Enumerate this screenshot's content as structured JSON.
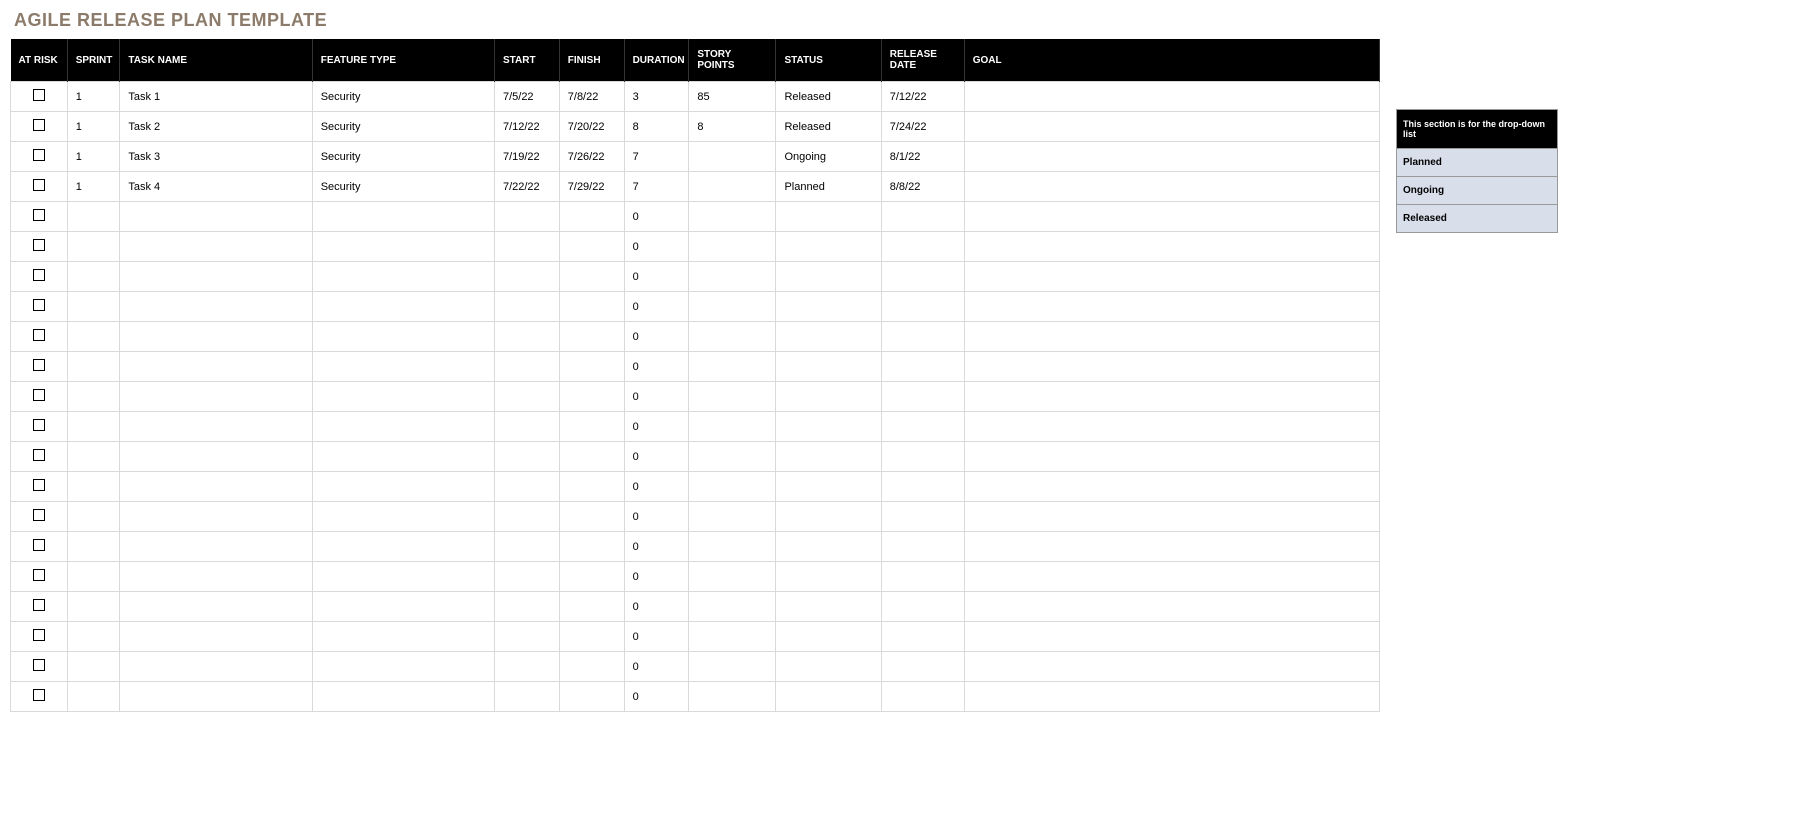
{
  "title": "AGILE RELEASE PLAN TEMPLATE",
  "columns": [
    "AT RISK",
    "SPRINT",
    "TASK NAME",
    "FEATURE TYPE",
    "START",
    "FINISH",
    "DURATION",
    "STORY POINTS",
    "STATUS",
    "RELEASE DATE",
    "GOAL"
  ],
  "rows": [
    {
      "at_risk": false,
      "sprint": "1",
      "task_name": "Task 1",
      "feature_type": "Security",
      "start": "7/5/22",
      "finish": "7/8/22",
      "duration": "3",
      "story_points": "85",
      "status": "Released",
      "release_date": "7/12/22",
      "goal": ""
    },
    {
      "at_risk": false,
      "sprint": "1",
      "task_name": "Task 2",
      "feature_type": "Security",
      "start": "7/12/22",
      "finish": "7/20/22",
      "duration": "8",
      "story_points": "8",
      "status": "Released",
      "release_date": "7/24/22",
      "goal": ""
    },
    {
      "at_risk": false,
      "sprint": "1",
      "task_name": "Task 3",
      "feature_type": "Security",
      "start": "7/19/22",
      "finish": "7/26/22",
      "duration": "7",
      "story_points": "",
      "status": "Ongoing",
      "release_date": "8/1/22",
      "goal": ""
    },
    {
      "at_risk": false,
      "sprint": "1",
      "task_name": "Task 4",
      "feature_type": "Security",
      "start": "7/22/22",
      "finish": "7/29/22",
      "duration": "7",
      "story_points": "",
      "status": "Planned",
      "release_date": "8/8/22",
      "goal": ""
    },
    {
      "at_risk": false,
      "sprint": "",
      "task_name": "",
      "feature_type": "",
      "start": "",
      "finish": "",
      "duration": "0",
      "story_points": "",
      "status": "",
      "release_date": "",
      "goal": ""
    },
    {
      "at_risk": false,
      "sprint": "",
      "task_name": "",
      "feature_type": "",
      "start": "",
      "finish": "",
      "duration": "0",
      "story_points": "",
      "status": "",
      "release_date": "",
      "goal": ""
    },
    {
      "at_risk": false,
      "sprint": "",
      "task_name": "",
      "feature_type": "",
      "start": "",
      "finish": "",
      "duration": "0",
      "story_points": "",
      "status": "",
      "release_date": "",
      "goal": ""
    },
    {
      "at_risk": false,
      "sprint": "",
      "task_name": "",
      "feature_type": "",
      "start": "",
      "finish": "",
      "duration": "0",
      "story_points": "",
      "status": "",
      "release_date": "",
      "goal": ""
    },
    {
      "at_risk": false,
      "sprint": "",
      "task_name": "",
      "feature_type": "",
      "start": "",
      "finish": "",
      "duration": "0",
      "story_points": "",
      "status": "",
      "release_date": "",
      "goal": ""
    },
    {
      "at_risk": false,
      "sprint": "",
      "task_name": "",
      "feature_type": "",
      "start": "",
      "finish": "",
      "duration": "0",
      "story_points": "",
      "status": "",
      "release_date": "",
      "goal": ""
    },
    {
      "at_risk": false,
      "sprint": "",
      "task_name": "",
      "feature_type": "",
      "start": "",
      "finish": "",
      "duration": "0",
      "story_points": "",
      "status": "",
      "release_date": "",
      "goal": ""
    },
    {
      "at_risk": false,
      "sprint": "",
      "task_name": "",
      "feature_type": "",
      "start": "",
      "finish": "",
      "duration": "0",
      "story_points": "",
      "status": "",
      "release_date": "",
      "goal": ""
    },
    {
      "at_risk": false,
      "sprint": "",
      "task_name": "",
      "feature_type": "",
      "start": "",
      "finish": "",
      "duration": "0",
      "story_points": "",
      "status": "",
      "release_date": "",
      "goal": ""
    },
    {
      "at_risk": false,
      "sprint": "",
      "task_name": "",
      "feature_type": "",
      "start": "",
      "finish": "",
      "duration": "0",
      "story_points": "",
      "status": "",
      "release_date": "",
      "goal": ""
    },
    {
      "at_risk": false,
      "sprint": "",
      "task_name": "",
      "feature_type": "",
      "start": "",
      "finish": "",
      "duration": "0",
      "story_points": "",
      "status": "",
      "release_date": "",
      "goal": ""
    },
    {
      "at_risk": false,
      "sprint": "",
      "task_name": "",
      "feature_type": "",
      "start": "",
      "finish": "",
      "duration": "0",
      "story_points": "",
      "status": "",
      "release_date": "",
      "goal": ""
    },
    {
      "at_risk": false,
      "sprint": "",
      "task_name": "",
      "feature_type": "",
      "start": "",
      "finish": "",
      "duration": "0",
      "story_points": "",
      "status": "",
      "release_date": "",
      "goal": ""
    },
    {
      "at_risk": false,
      "sprint": "",
      "task_name": "",
      "feature_type": "",
      "start": "",
      "finish": "",
      "duration": "0",
      "story_points": "",
      "status": "",
      "release_date": "",
      "goal": ""
    },
    {
      "at_risk": false,
      "sprint": "",
      "task_name": "",
      "feature_type": "",
      "start": "",
      "finish": "",
      "duration": "0",
      "story_points": "",
      "status": "",
      "release_date": "",
      "goal": ""
    },
    {
      "at_risk": false,
      "sprint": "",
      "task_name": "",
      "feature_type": "",
      "start": "",
      "finish": "",
      "duration": "0",
      "story_points": "",
      "status": "",
      "release_date": "",
      "goal": ""
    },
    {
      "at_risk": false,
      "sprint": "",
      "task_name": "",
      "feature_type": "",
      "start": "",
      "finish": "",
      "duration": "0",
      "story_points": "",
      "status": "",
      "release_date": "",
      "goal": ""
    }
  ],
  "dropdown_panel": {
    "header": "This section is for the drop-down list",
    "items": [
      "Planned",
      "Ongoing",
      "Released"
    ]
  }
}
